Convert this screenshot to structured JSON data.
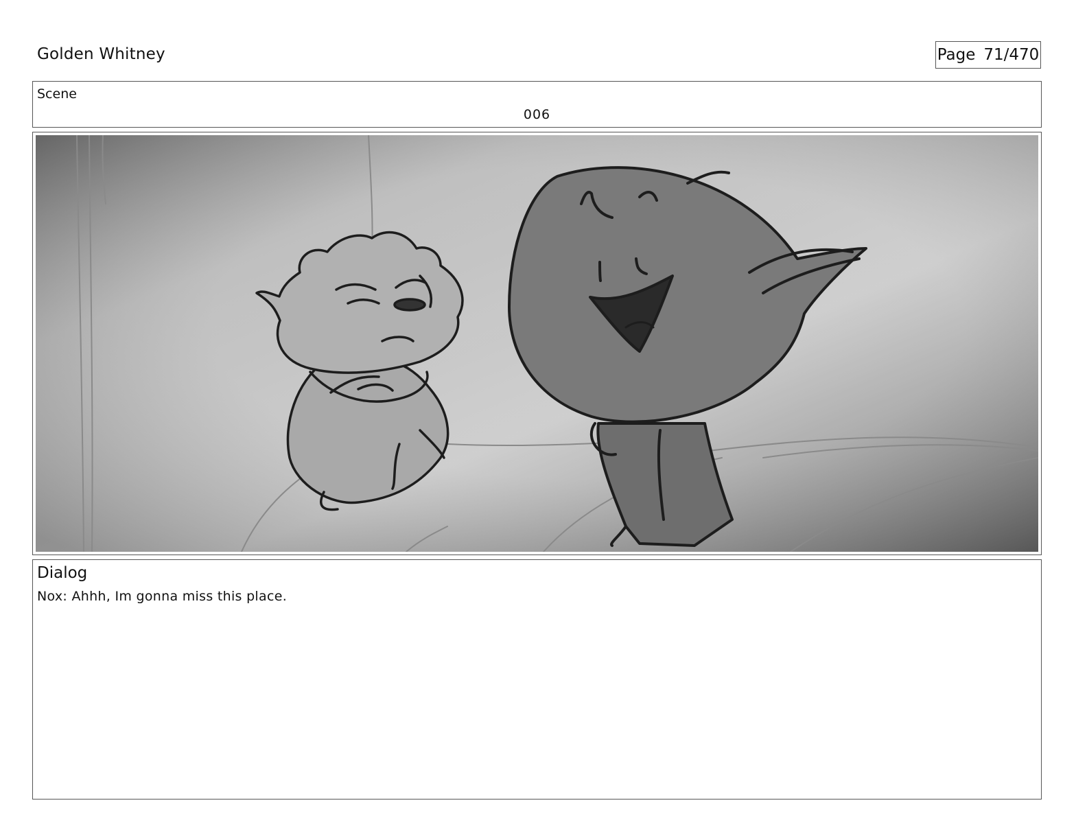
{
  "header": {
    "project_title": "Golden Whitney",
    "page_label": "Page",
    "page_value": "71/470"
  },
  "scene": {
    "label": "Scene",
    "number": "006"
  },
  "panel": {
    "image_icon": "storyboard-sketch-image"
  },
  "dialog": {
    "label": "Dialog",
    "lines": [
      "Nox: Ahhh, Im gonna miss this place."
    ]
  }
}
